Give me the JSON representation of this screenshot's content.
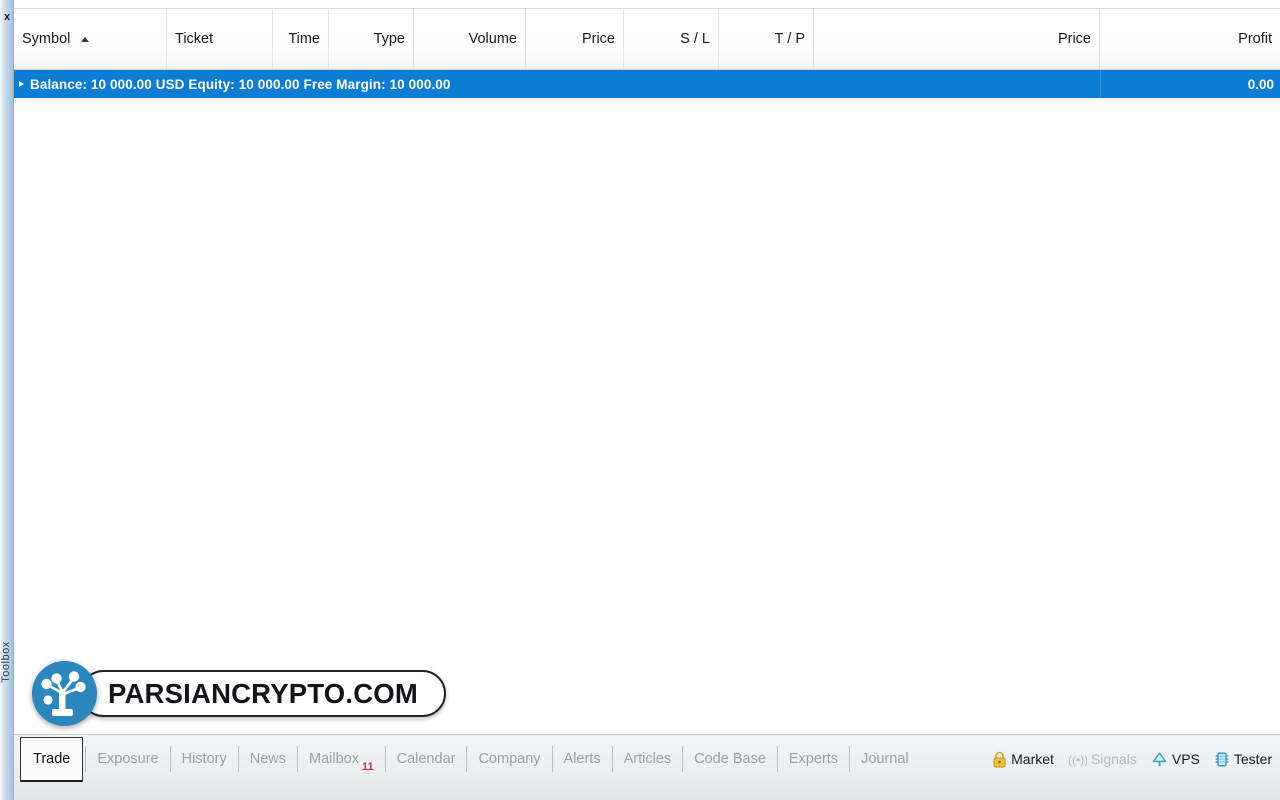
{
  "dock": {
    "close_label": "x",
    "panel_label": "Toolbox"
  },
  "table": {
    "columns": [
      {
        "label": "Symbol",
        "align": "left",
        "sorted": true
      },
      {
        "label": "Ticket",
        "align": "left",
        "sorted": false
      },
      {
        "label": "Time",
        "align": "right",
        "sorted": false
      },
      {
        "label": "Type",
        "align": "right",
        "sorted": false
      },
      {
        "label": "Volume",
        "align": "right",
        "sorted": false
      },
      {
        "label": "Price",
        "align": "right",
        "sorted": false
      },
      {
        "label": "S / L",
        "align": "right",
        "sorted": false
      },
      {
        "label": "T / P",
        "align": "right",
        "sorted": false
      },
      {
        "label": "Price",
        "align": "right",
        "sorted": false
      },
      {
        "label": "Profit",
        "align": "right",
        "sorted": false
      }
    ],
    "summary_row": {
      "text": "Balance: 10 000.00 USD  Equity: 10 000.00  Free Margin: 10 000.00",
      "balance_label": "Balance:",
      "balance_value": "10 000.00 USD",
      "equity_label": "Equity:",
      "equity_value": "10 000.00",
      "free_margin_label": "Free Margin:",
      "free_margin_value": "10 000.00",
      "profit": "0.00",
      "selected": true,
      "highlight_color": "#0c7cd5"
    },
    "rows": []
  },
  "tabs": [
    {
      "label": "Trade",
      "active": true,
      "badge": ""
    },
    {
      "label": "Exposure",
      "active": false,
      "badge": ""
    },
    {
      "label": "History",
      "active": false,
      "badge": ""
    },
    {
      "label": "News",
      "active": false,
      "badge": ""
    },
    {
      "label": "Mailbox",
      "active": false,
      "badge": "11"
    },
    {
      "label": "Calendar",
      "active": false,
      "badge": ""
    },
    {
      "label": "Company",
      "active": false,
      "badge": ""
    },
    {
      "label": "Alerts",
      "active": false,
      "badge": ""
    },
    {
      "label": "Articles",
      "active": false,
      "badge": ""
    },
    {
      "label": "Code Base",
      "active": false,
      "badge": ""
    },
    {
      "label": "Experts",
      "active": false,
      "badge": ""
    },
    {
      "label": "Journal",
      "active": false,
      "badge": ""
    }
  ],
  "status_items": [
    {
      "label": "Market",
      "icon": "lock-icon",
      "enabled": true
    },
    {
      "label": "Signals",
      "icon": "antenna-icon",
      "enabled": false
    },
    {
      "label": "VPS",
      "icon": "cloud-icon",
      "enabled": true
    },
    {
      "label": "Tester",
      "icon": "chip-icon",
      "enabled": true
    }
  ],
  "watermark": {
    "text": "PARSIANCRYPTO.COM",
    "logo_color": "#2b87bd"
  },
  "colors": {
    "selection_blue": "#0c7cd5",
    "badge_red": "#cf2e3c",
    "lock_yellow": "#f2c53d",
    "vps_blue": "#3a9fd8"
  }
}
